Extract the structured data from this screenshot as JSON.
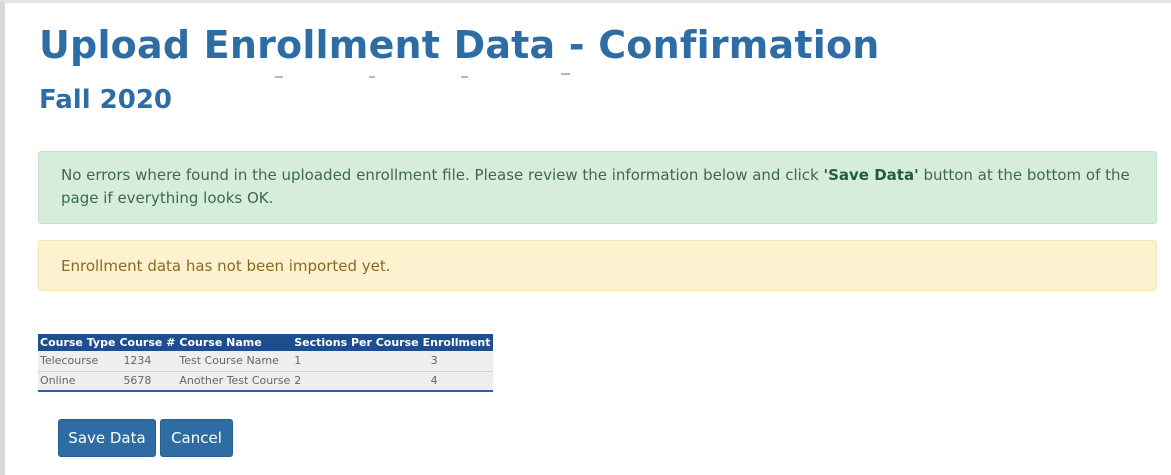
{
  "page": {
    "title": "Upload Enrollment Data - Confirmation",
    "subtitle": "Fall 2020"
  },
  "alerts": {
    "success_before": "No errors where found in the uploaded enrollment file. Please review the information below and click ",
    "success_strong": "'Save Data'",
    "success_after": " button at the bottom of the page if everything looks OK.",
    "warning": "Enrollment data has not been imported yet."
  },
  "table": {
    "headers": [
      "Course Type",
      "Course #",
      "Course Name",
      "Sections Per Course",
      "Enrollment"
    ],
    "rows": [
      [
        "Telecourse",
        "1234",
        "Test Course Name",
        "1",
        "3"
      ],
      [
        "Online",
        "5678",
        "Another Test Course",
        "2",
        "4"
      ]
    ]
  },
  "buttons": {
    "save": "Save Data",
    "cancel": "Cancel"
  },
  "colors": {
    "brand": "#2e6da4",
    "table_header": "#1f4e8c",
    "success_bg": "#d6eddc",
    "warning_bg": "#fcf2d0"
  }
}
